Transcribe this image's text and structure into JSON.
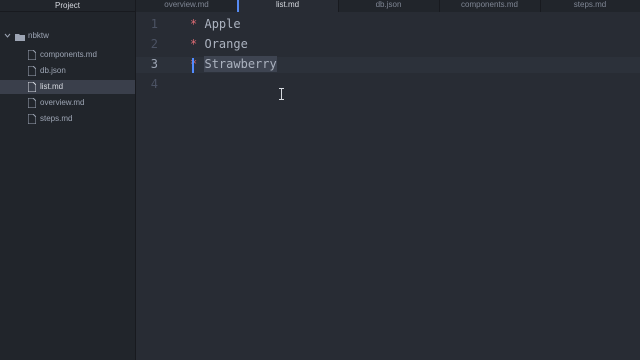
{
  "sidebar": {
    "title": "Project",
    "folder": "nbktw",
    "files": [
      "components.md",
      "db.json",
      "list.md",
      "overview.md",
      "steps.md"
    ]
  },
  "tabs": [
    "overview.md",
    "list.md",
    "db.json",
    "components.md",
    "steps.md"
  ],
  "editor": {
    "line_numbers": [
      "1",
      "2",
      "3",
      "4"
    ],
    "bullet": "*",
    "items": [
      "Apple",
      "Orange",
      "Strawberry"
    ]
  },
  "colors": {
    "accent": "#568af2",
    "bullet": "#e06c75",
    "background": "#282c34",
    "sidebar": "#21252b"
  }
}
